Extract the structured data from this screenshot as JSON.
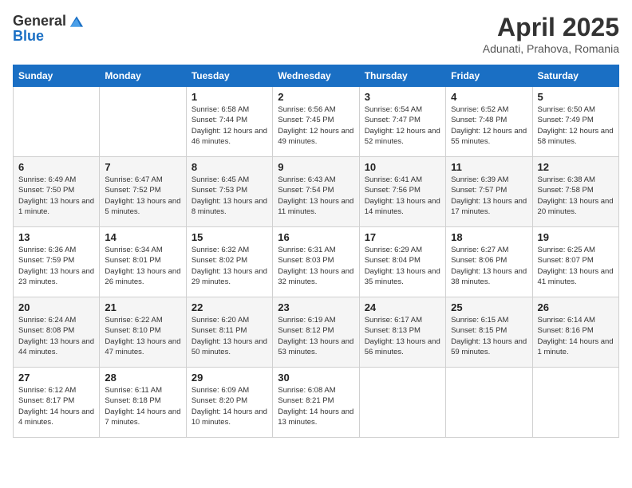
{
  "header": {
    "logo_general": "General",
    "logo_blue": "Blue",
    "title": "April 2025",
    "subtitle": "Adunati, Prahova, Romania"
  },
  "weekdays": [
    "Sunday",
    "Monday",
    "Tuesday",
    "Wednesday",
    "Thursday",
    "Friday",
    "Saturday"
  ],
  "weeks": [
    [
      {
        "day": "",
        "sunrise": "",
        "sunset": "",
        "daylight": ""
      },
      {
        "day": "",
        "sunrise": "",
        "sunset": "",
        "daylight": ""
      },
      {
        "day": "1",
        "sunrise": "Sunrise: 6:58 AM",
        "sunset": "Sunset: 7:44 PM",
        "daylight": "Daylight: 12 hours and 46 minutes."
      },
      {
        "day": "2",
        "sunrise": "Sunrise: 6:56 AM",
        "sunset": "Sunset: 7:45 PM",
        "daylight": "Daylight: 12 hours and 49 minutes."
      },
      {
        "day": "3",
        "sunrise": "Sunrise: 6:54 AM",
        "sunset": "Sunset: 7:47 PM",
        "daylight": "Daylight: 12 hours and 52 minutes."
      },
      {
        "day": "4",
        "sunrise": "Sunrise: 6:52 AM",
        "sunset": "Sunset: 7:48 PM",
        "daylight": "Daylight: 12 hours and 55 minutes."
      },
      {
        "day": "5",
        "sunrise": "Sunrise: 6:50 AM",
        "sunset": "Sunset: 7:49 PM",
        "daylight": "Daylight: 12 hours and 58 minutes."
      }
    ],
    [
      {
        "day": "6",
        "sunrise": "Sunrise: 6:49 AM",
        "sunset": "Sunset: 7:50 PM",
        "daylight": "Daylight: 13 hours and 1 minute."
      },
      {
        "day": "7",
        "sunrise": "Sunrise: 6:47 AM",
        "sunset": "Sunset: 7:52 PM",
        "daylight": "Daylight: 13 hours and 5 minutes."
      },
      {
        "day": "8",
        "sunrise": "Sunrise: 6:45 AM",
        "sunset": "Sunset: 7:53 PM",
        "daylight": "Daylight: 13 hours and 8 minutes."
      },
      {
        "day": "9",
        "sunrise": "Sunrise: 6:43 AM",
        "sunset": "Sunset: 7:54 PM",
        "daylight": "Daylight: 13 hours and 11 minutes."
      },
      {
        "day": "10",
        "sunrise": "Sunrise: 6:41 AM",
        "sunset": "Sunset: 7:56 PM",
        "daylight": "Daylight: 13 hours and 14 minutes."
      },
      {
        "day": "11",
        "sunrise": "Sunrise: 6:39 AM",
        "sunset": "Sunset: 7:57 PM",
        "daylight": "Daylight: 13 hours and 17 minutes."
      },
      {
        "day": "12",
        "sunrise": "Sunrise: 6:38 AM",
        "sunset": "Sunset: 7:58 PM",
        "daylight": "Daylight: 13 hours and 20 minutes."
      }
    ],
    [
      {
        "day": "13",
        "sunrise": "Sunrise: 6:36 AM",
        "sunset": "Sunset: 7:59 PM",
        "daylight": "Daylight: 13 hours and 23 minutes."
      },
      {
        "day": "14",
        "sunrise": "Sunrise: 6:34 AM",
        "sunset": "Sunset: 8:01 PM",
        "daylight": "Daylight: 13 hours and 26 minutes."
      },
      {
        "day": "15",
        "sunrise": "Sunrise: 6:32 AM",
        "sunset": "Sunset: 8:02 PM",
        "daylight": "Daylight: 13 hours and 29 minutes."
      },
      {
        "day": "16",
        "sunrise": "Sunrise: 6:31 AM",
        "sunset": "Sunset: 8:03 PM",
        "daylight": "Daylight: 13 hours and 32 minutes."
      },
      {
        "day": "17",
        "sunrise": "Sunrise: 6:29 AM",
        "sunset": "Sunset: 8:04 PM",
        "daylight": "Daylight: 13 hours and 35 minutes."
      },
      {
        "day": "18",
        "sunrise": "Sunrise: 6:27 AM",
        "sunset": "Sunset: 8:06 PM",
        "daylight": "Daylight: 13 hours and 38 minutes."
      },
      {
        "day": "19",
        "sunrise": "Sunrise: 6:25 AM",
        "sunset": "Sunset: 8:07 PM",
        "daylight": "Daylight: 13 hours and 41 minutes."
      }
    ],
    [
      {
        "day": "20",
        "sunrise": "Sunrise: 6:24 AM",
        "sunset": "Sunset: 8:08 PM",
        "daylight": "Daylight: 13 hours and 44 minutes."
      },
      {
        "day": "21",
        "sunrise": "Sunrise: 6:22 AM",
        "sunset": "Sunset: 8:10 PM",
        "daylight": "Daylight: 13 hours and 47 minutes."
      },
      {
        "day": "22",
        "sunrise": "Sunrise: 6:20 AM",
        "sunset": "Sunset: 8:11 PM",
        "daylight": "Daylight: 13 hours and 50 minutes."
      },
      {
        "day": "23",
        "sunrise": "Sunrise: 6:19 AM",
        "sunset": "Sunset: 8:12 PM",
        "daylight": "Daylight: 13 hours and 53 minutes."
      },
      {
        "day": "24",
        "sunrise": "Sunrise: 6:17 AM",
        "sunset": "Sunset: 8:13 PM",
        "daylight": "Daylight: 13 hours and 56 minutes."
      },
      {
        "day": "25",
        "sunrise": "Sunrise: 6:15 AM",
        "sunset": "Sunset: 8:15 PM",
        "daylight": "Daylight: 13 hours and 59 minutes."
      },
      {
        "day": "26",
        "sunrise": "Sunrise: 6:14 AM",
        "sunset": "Sunset: 8:16 PM",
        "daylight": "Daylight: 14 hours and 1 minute."
      }
    ],
    [
      {
        "day": "27",
        "sunrise": "Sunrise: 6:12 AM",
        "sunset": "Sunset: 8:17 PM",
        "daylight": "Daylight: 14 hours and 4 minutes."
      },
      {
        "day": "28",
        "sunrise": "Sunrise: 6:11 AM",
        "sunset": "Sunset: 8:18 PM",
        "daylight": "Daylight: 14 hours and 7 minutes."
      },
      {
        "day": "29",
        "sunrise": "Sunrise: 6:09 AM",
        "sunset": "Sunset: 8:20 PM",
        "daylight": "Daylight: 14 hours and 10 minutes."
      },
      {
        "day": "30",
        "sunrise": "Sunrise: 6:08 AM",
        "sunset": "Sunset: 8:21 PM",
        "daylight": "Daylight: 14 hours and 13 minutes."
      },
      {
        "day": "",
        "sunrise": "",
        "sunset": "",
        "daylight": ""
      },
      {
        "day": "",
        "sunrise": "",
        "sunset": "",
        "daylight": ""
      },
      {
        "day": "",
        "sunrise": "",
        "sunset": "",
        "daylight": ""
      }
    ]
  ]
}
